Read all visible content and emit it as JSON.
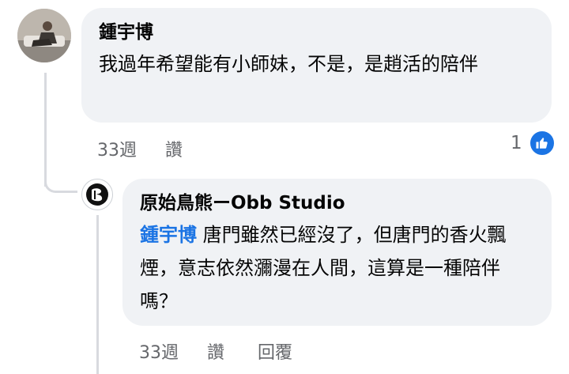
{
  "comment": {
    "author": "鍾宇博",
    "text": "我過年希望能有小師妹，不是，是趙活的陪伴",
    "time": "33週",
    "like_label": "讚",
    "reaction_count": "1",
    "reaction_type": "like-icon"
  },
  "reply": {
    "author": "原始鳥熊ーObb Studio",
    "mention": "鍾宇博",
    "text": " 唐門雖然已經沒了，但唐門的香火飄煙，意志依然瀰漫在人間，這算是一種陪伴嗎？",
    "time": "33週",
    "like_label": "讚",
    "reply_label": "回覆"
  },
  "colors": {
    "bubble": "#f0f2f5",
    "mention": "#1b74e4",
    "meta_text": "#65676b",
    "like_badge": "#1b74e4"
  }
}
